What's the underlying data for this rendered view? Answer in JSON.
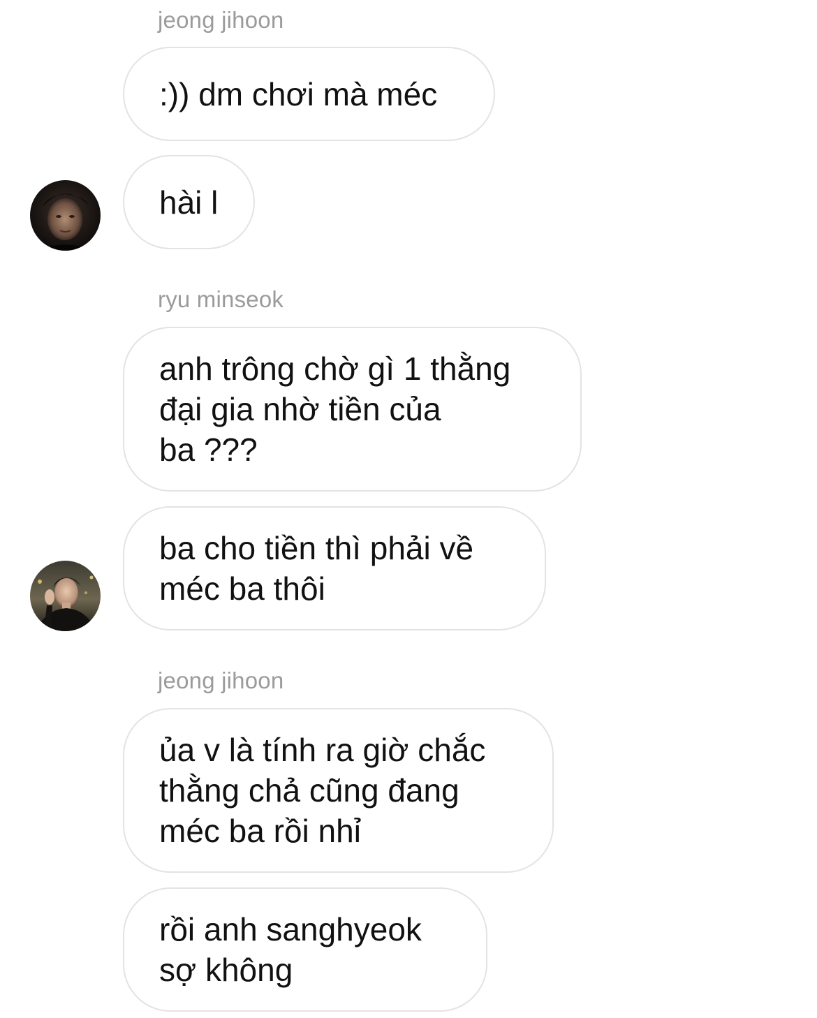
{
  "conversation": {
    "groups": [
      {
        "sender": "jeong jihoon",
        "avatar_icon": "user-avatar-dark-portrait-icon",
        "messages": [
          ":)) dm chơi mà méc",
          "hài l"
        ]
      },
      {
        "sender": "ryu minseok",
        "avatar_icon": "user-avatar-selfie-night-icon",
        "messages": [
          "anh trông chờ gì 1 thằng\nđại gia nhờ tiền của\nba ???",
          "ba cho tiền thì phải về\nméc ba thôi"
        ]
      },
      {
        "sender": "jeong jihoon",
        "messages": [
          "ủa v là tính ra giờ chắc\nthằng chả cũng đang\nméc ba rồi nhỉ",
          "rồi anh sanghyeok\nsợ không"
        ]
      }
    ]
  },
  "colors": {
    "bubble_border": "#e3e3e3",
    "sender_text": "#9b9b9b",
    "message_text": "#111111",
    "background": "#ffffff"
  }
}
